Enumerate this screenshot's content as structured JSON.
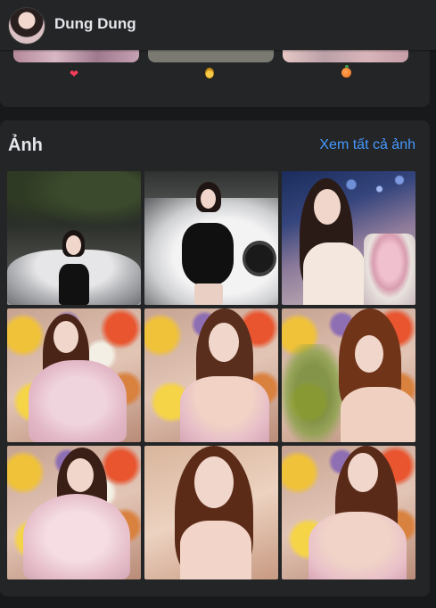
{
  "header": {
    "name": "Dung Dung"
  },
  "previous_section": {
    "reactions": [
      {
        "icon": "heart-icon",
        "glyph": "❤"
      },
      {
        "icon": "medal-icon",
        "glyph": ""
      },
      {
        "icon": "orange-fruit-icon",
        "glyph": ""
      }
    ]
  },
  "photos": {
    "title": "Ảnh",
    "see_all_label": "Xem tất cả ảnh",
    "items": [
      {
        "name": "photo-1"
      },
      {
        "name": "photo-2"
      },
      {
        "name": "photo-3"
      },
      {
        "name": "photo-4"
      },
      {
        "name": "photo-5"
      },
      {
        "name": "photo-6"
      },
      {
        "name": "photo-7"
      },
      {
        "name": "photo-8"
      },
      {
        "name": "photo-9"
      }
    ]
  },
  "colors": {
    "background": "#18191a",
    "card": "#242526",
    "link": "#4599ff",
    "text": "#e4e6eb",
    "heart": "#f33e58"
  }
}
